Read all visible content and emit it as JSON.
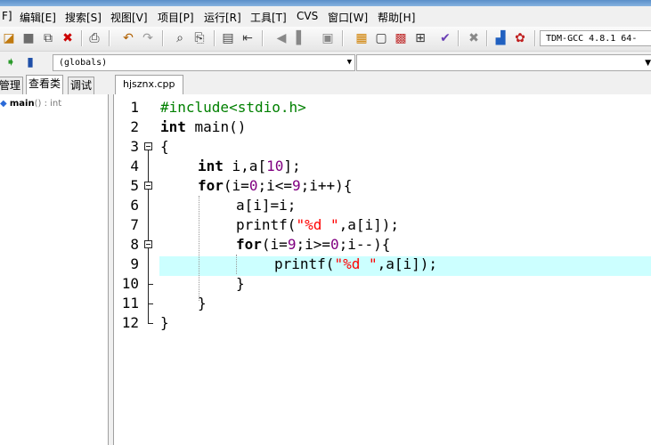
{
  "menu": {
    "items": [
      "F]",
      "编辑[E]",
      "搜索[S]",
      "视图[V]",
      "项目[P]",
      "运行[R]",
      "工具[T]",
      "CVS",
      "窗口[W]",
      "帮助[H]"
    ]
  },
  "toolbar": {
    "compiler": "TDM-GCC 4.8.1 64-"
  },
  "toolbar2": {
    "scope": "(globals)"
  },
  "left_panel": {
    "tabs": [
      "管理",
      "查看类",
      "调试"
    ],
    "tree": {
      "name": "main",
      "signature": "() : int"
    }
  },
  "editor": {
    "tab": "hjsznx.cpp",
    "line_numbers": [
      "1",
      "2",
      "3",
      "4",
      "5",
      "6",
      "7",
      "8",
      "9",
      "10",
      "11",
      "12"
    ],
    "highlight_color": "#ccffff",
    "code": {
      "l1": "#include<stdio.h>",
      "l2_kw": "int",
      "l2_rest": " main()",
      "l3": "{",
      "l4_kw": "int",
      "l4_a": " i,a[",
      "l4_num": "10",
      "l4_b": "];",
      "l5_kw": "for",
      "l5_a": "(i=",
      "l5_n1": "0",
      "l5_b": ";i<=",
      "l5_n2": "9",
      "l5_c": ";i++){",
      "l6": "a[i]=i;",
      "l7_a": "printf(",
      "l7_str": "\"%d \"",
      "l7_b": ",a[i]);",
      "l8_kw": "for",
      "l8_a": "(i=",
      "l8_n1": "9",
      "l8_b": ";i>=",
      "l8_n2": "0",
      "l8_c": ";i--){",
      "l9_a": "printf(",
      "l9_str": "\"%d \"",
      "l9_b": ",a[i]);",
      "l10": "}",
      "l11": "}",
      "l12": "}"
    }
  }
}
